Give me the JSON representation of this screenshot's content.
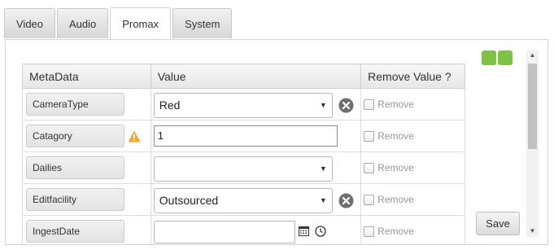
{
  "tabs": [
    {
      "label": "Video",
      "active": false
    },
    {
      "label": "Audio",
      "active": false
    },
    {
      "label": "Promax",
      "active": true
    },
    {
      "label": "System",
      "active": false
    }
  ],
  "table": {
    "headers": [
      "MetaData",
      "Value",
      "Remove Value ?"
    ],
    "rows": [
      {
        "key": "CameraType",
        "type": "select",
        "value": "Red",
        "clearable": true,
        "warning": false,
        "remove_label": "Remove"
      },
      {
        "key": "Catagory",
        "type": "text",
        "value": "1",
        "clearable": false,
        "warning": true,
        "remove_label": "Remove"
      },
      {
        "key": "Dailies",
        "type": "select",
        "value": "",
        "clearable": false,
        "warning": false,
        "remove_label": "Remove"
      },
      {
        "key": "Editfacility",
        "type": "select",
        "value": "Outsourced",
        "clearable": true,
        "warning": false,
        "remove_label": "Remove"
      },
      {
        "key": "IngestDate",
        "type": "date",
        "value": "",
        "clearable": false,
        "warning": false,
        "remove_label": "Remove"
      }
    ]
  },
  "save_label": "Save",
  "colors": {
    "layout_toggle": "#7dc242",
    "warning": "#f5a623",
    "clear_icon": "#6f6f6f"
  },
  "icons": {
    "layout_toggle": "split-view-icon",
    "clear": "clear-circle-icon",
    "warning": "warning-triangle-icon",
    "calendar": "calendar-icon",
    "clock": "clock-icon"
  }
}
